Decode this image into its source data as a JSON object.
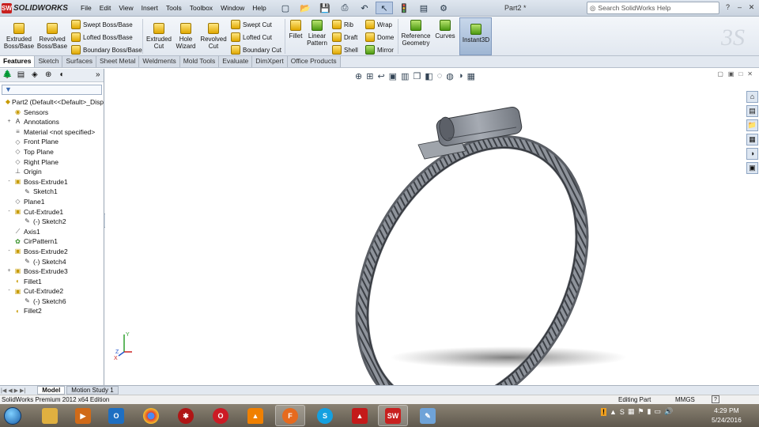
{
  "app": {
    "brand": "SOLIDWORKS",
    "doc_title": "Part2 *"
  },
  "menus": [
    "File",
    "Edit",
    "View",
    "Insert",
    "Tools",
    "Toolbox",
    "Window",
    "Help"
  ],
  "search": {
    "placeholder": "Search SolidWorks Help"
  },
  "ribbon": {
    "extruded_boss": "Extruded Boss/Base",
    "revolved_boss": "Revolved Boss/Base",
    "swept_boss": "Swept Boss/Base",
    "lofted_boss": "Lofted Boss/Base",
    "boundary_boss": "Boundary Boss/Base",
    "extruded_cut": "Extruded Cut",
    "hole_wizard": "Hole Wizard",
    "revolved_cut": "Revolved Cut",
    "swept_cut": "Swept Cut",
    "lofted_cut": "Lofted Cut",
    "boundary_cut": "Boundary Cut",
    "fillet": "Fillet",
    "linear_pattern": "Linear Pattern",
    "rib": "Rib",
    "draft": "Draft",
    "shell": "Shell",
    "wrap": "Wrap",
    "dome": "Dome",
    "mirror": "Mirror",
    "reference_geometry": "Reference Geometry",
    "curves": "Curves",
    "instant3d": "Instant3D"
  },
  "tabs": [
    "Features",
    "Sketch",
    "Surfaces",
    "Sheet Metal",
    "Weldments",
    "Mold Tools",
    "Evaluate",
    "DimXpert",
    "Office Products"
  ],
  "tree": [
    {
      "label": "Part2  (Default<<Default>_Disp",
      "icon": "part-icon",
      "indent": 0,
      "expand": ""
    },
    {
      "label": "Sensors",
      "icon": "sensors-icon",
      "indent": 1,
      "expand": ""
    },
    {
      "label": "Annotations",
      "icon": "annotations-icon",
      "indent": 1,
      "expand": "+"
    },
    {
      "label": "Material <not specified>",
      "icon": "material-icon",
      "indent": 1,
      "expand": ""
    },
    {
      "label": "Front Plane",
      "icon": "plane-icon",
      "indent": 1,
      "expand": ""
    },
    {
      "label": "Top Plane",
      "icon": "plane-icon",
      "indent": 1,
      "expand": ""
    },
    {
      "label": "Right Plane",
      "icon": "plane-icon",
      "indent": 1,
      "expand": ""
    },
    {
      "label": "Origin",
      "icon": "origin-icon",
      "indent": 1,
      "expand": ""
    },
    {
      "label": "Boss-Extrude1",
      "icon": "extrude-icon",
      "indent": 1,
      "expand": "-"
    },
    {
      "label": "Sketch1",
      "icon": "sketch-icon",
      "indent": 2,
      "expand": ""
    },
    {
      "label": "Plane1",
      "icon": "plane-icon",
      "indent": 1,
      "expand": ""
    },
    {
      "label": "Cut-Extrude1",
      "icon": "cut-icon",
      "indent": 1,
      "expand": "-"
    },
    {
      "label": "(-) Sketch2",
      "icon": "sketch-icon",
      "indent": 2,
      "expand": ""
    },
    {
      "label": "Axis1",
      "icon": "axis-icon",
      "indent": 1,
      "expand": ""
    },
    {
      "label": "CirPattern1",
      "icon": "pattern-icon",
      "indent": 1,
      "expand": ""
    },
    {
      "label": "Boss-Extrude2",
      "icon": "extrude-icon",
      "indent": 1,
      "expand": "-"
    },
    {
      "label": "(-) Sketch4",
      "icon": "sketch-icon",
      "indent": 2,
      "expand": ""
    },
    {
      "label": "Boss-Extrude3",
      "icon": "extrude-icon",
      "indent": 1,
      "expand": "+"
    },
    {
      "label": "Fillet1",
      "icon": "fillet-icon",
      "indent": 1,
      "expand": ""
    },
    {
      "label": "Cut-Extrude2",
      "icon": "cut-icon",
      "indent": 1,
      "expand": "-"
    },
    {
      "label": "(-) Sketch6",
      "icon": "sketch-icon",
      "indent": 2,
      "expand": ""
    },
    {
      "label": "Fillet2",
      "icon": "fillet-icon",
      "indent": 1,
      "expand": ""
    }
  ],
  "bottom_tabs": [
    "Model",
    "Motion Study 1"
  ],
  "status": {
    "product": "SolidWorks Premium 2012 x64 Edition",
    "mode": "Editing Part",
    "units": "MMGS",
    "help": "?"
  },
  "clock": {
    "time": "4:29 PM",
    "date": "5/24/2016"
  },
  "taskbar": {
    "outlook": "O",
    "opera": "O",
    "firefox": "F",
    "skype": "S",
    "solidworks": "SW"
  },
  "triad": {
    "x": "X",
    "y": "Y",
    "z": "Z"
  },
  "colors": {
    "accent": "#2f6fb5",
    "brand": "#c8201f",
    "part": "#8c9099"
  }
}
